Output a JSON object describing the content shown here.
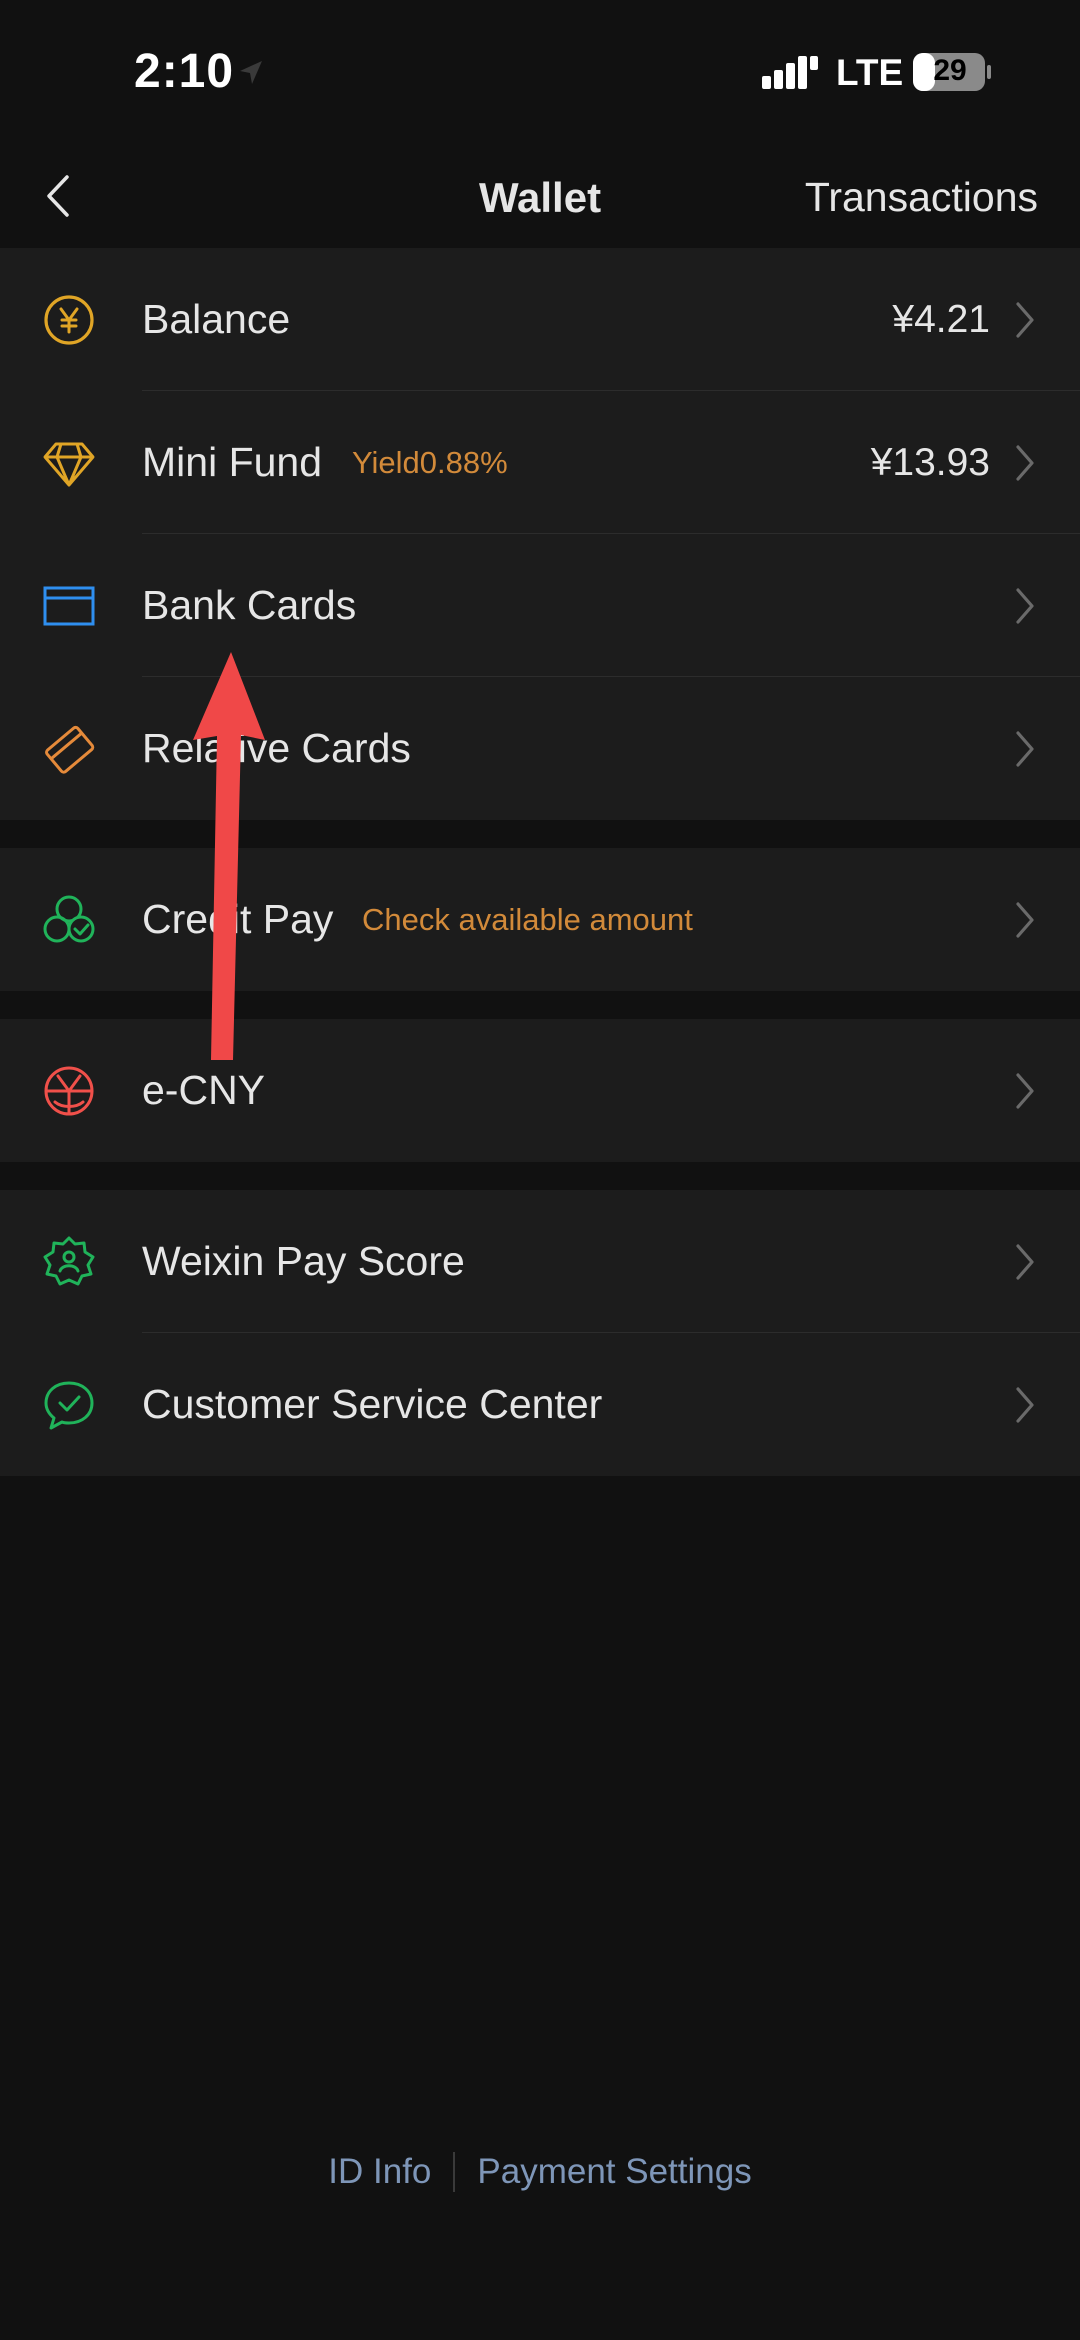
{
  "status_bar": {
    "time": "2:10",
    "network": "LTE",
    "battery": "29",
    "icons": [
      "location-icon",
      "signal-icon",
      "battery-icon"
    ]
  },
  "nav": {
    "title": "Wallet",
    "right_action": "Transactions",
    "back_icon": "chevron-left-icon"
  },
  "groups": [
    {
      "items": [
        {
          "id": "balance",
          "label": "Balance",
          "value": "¥4.21",
          "icon": "yen-coin-icon",
          "icon_color": "#e0a526"
        },
        {
          "id": "mini-fund",
          "label": "Mini Fund",
          "tag": "Yield0.88%",
          "value": "¥13.93",
          "icon": "diamond-icon",
          "icon_color": "#e0a526"
        },
        {
          "id": "bank-cards",
          "label": "Bank Cards",
          "icon": "card-icon",
          "icon_color": "#2f8ff0"
        },
        {
          "id": "relative-cards",
          "label": "Relative Cards",
          "icon": "rotated-card-icon",
          "icon_color": "#e58a3a"
        }
      ]
    },
    {
      "items": [
        {
          "id": "credit-pay",
          "label": "Credit Pay",
          "tag": "Check available amount",
          "icon": "clover-check-icon",
          "icon_color": "#20b35a"
        }
      ]
    },
    {
      "items": [
        {
          "id": "e-cny",
          "label": "e-CNY",
          "icon": "ecny-globe-icon",
          "icon_color": "#f0504a"
        }
      ]
    },
    {
      "items": [
        {
          "id": "pay-score",
          "label": "Weixin Pay Score",
          "icon": "badge-person-icon",
          "icon_color": "#20b35a"
        },
        {
          "id": "customer-service",
          "label": "Customer Service Center",
          "icon": "chat-check-icon",
          "icon_color": "#20b35a"
        }
      ]
    }
  ],
  "footer": {
    "id_info": "ID Info",
    "payment_settings": "Payment Settings"
  },
  "colors": {
    "background": "#111111",
    "row_background": "#1c1c1c",
    "tag": "#d28a3a",
    "footer_link": "#7e96b8",
    "annotation_arrow": "#f04848"
  }
}
